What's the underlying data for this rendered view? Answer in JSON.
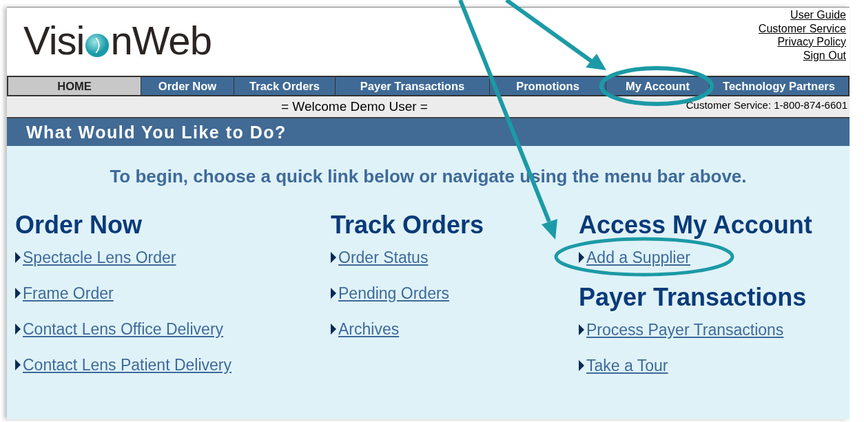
{
  "logo": {
    "before": "Visi",
    "after": "nWeb"
  },
  "header_links": [
    "User Guide",
    "Customer Service",
    "Privacy Policy",
    "Sign Out"
  ],
  "nav": [
    {
      "label": "HOME",
      "selected": true
    },
    {
      "label": "Order Now",
      "selected": false
    },
    {
      "label": "Track Orders",
      "selected": false
    },
    {
      "label": "Payer Transactions",
      "selected": false
    },
    {
      "label": "Promotions",
      "selected": false
    },
    {
      "label": "My Account",
      "selected": false
    },
    {
      "label": "Technology Partners",
      "selected": false
    }
  ],
  "welcome": "= Welcome Demo User =",
  "phone": "Customer Service: 1-800-874-6601",
  "banner": "What Would You Like to Do?",
  "intro": "To begin, choose a quick link below or navigate using the menu bar above.",
  "columns": [
    {
      "sections": [
        {
          "heading": "Order Now",
          "links": [
            "Spectacle Lens Order",
            "Frame Order",
            "Contact Lens Office Delivery",
            "Contact Lens Patient Delivery"
          ]
        }
      ]
    },
    {
      "sections": [
        {
          "heading": "Track Orders",
          "links": [
            "Order Status",
            "Pending Orders",
            "Archives"
          ]
        }
      ]
    },
    {
      "sections": [
        {
          "heading": "Access My Account",
          "links": [
            "Add a Supplier"
          ]
        },
        {
          "heading": "Payer Transactions",
          "links": [
            "Process Payer Transactions",
            "Take a Tour"
          ]
        }
      ]
    }
  ]
}
